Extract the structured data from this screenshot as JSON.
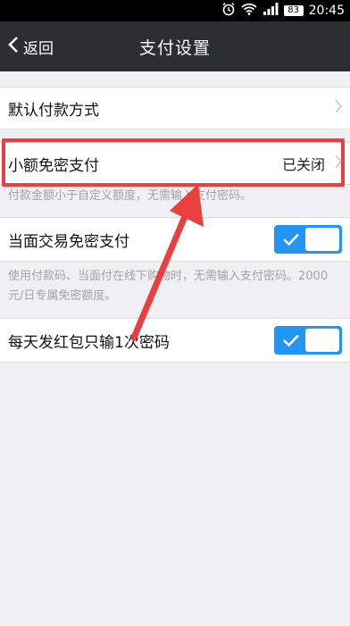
{
  "status_bar": {
    "battery": "83",
    "time": "20:45"
  },
  "nav": {
    "back_label": "返回",
    "title": "支付设置"
  },
  "settings": {
    "default_payment": {
      "label": "默认付款方式"
    },
    "small_amount": {
      "label": "小额免密支付",
      "value": "已关闭",
      "description": "付款金额小于自定义额度，无需输入支付密码。"
    },
    "face_to_face": {
      "label": "当面交易免密支付",
      "enabled": true,
      "description": "使用付款码、当面付在线下购物时，无需输入支付密码。2000元/日专属免密额度。"
    },
    "red_packet": {
      "label": "每天发红包只输1次密码",
      "enabled": true
    }
  },
  "colors": {
    "nav_bg": "#2d2e33",
    "toggle_on": "#2196f3",
    "annotation_red": "#e9403f",
    "page_bg": "#f0eff4"
  }
}
